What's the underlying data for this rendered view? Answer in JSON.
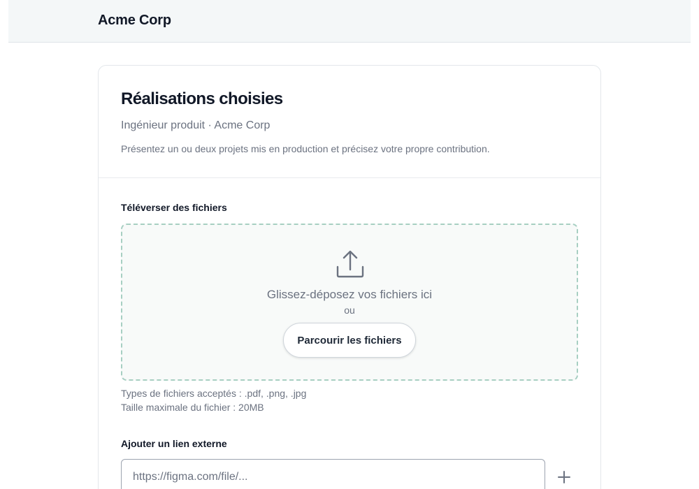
{
  "header": {
    "brand": "Acme Corp"
  },
  "card": {
    "title": "Réalisations choisies",
    "subtitle": "Ingénieur produit · Acme Corp",
    "description": "Présentez un ou deux projets mis en production et précisez votre propre contribution."
  },
  "upload": {
    "label": "Téléverser des fichiers",
    "icon": "upload-icon",
    "drop_text": "Glissez-déposez vos fichiers ici",
    "or_text": "ou",
    "browse_label": "Parcourir les fichiers",
    "accepted_types": "Types de fichiers acceptés : .pdf, .png, .jpg",
    "max_size": "Taille maximale du fichier : 20MB"
  },
  "link": {
    "label": "Ajouter un lien externe",
    "placeholder": "https://figma.com/file/...",
    "value": "",
    "add_icon": "plus-icon"
  },
  "colors": {
    "dropzone_border": "#a7cfc2",
    "topbar_bg": "#f4f7f8"
  }
}
